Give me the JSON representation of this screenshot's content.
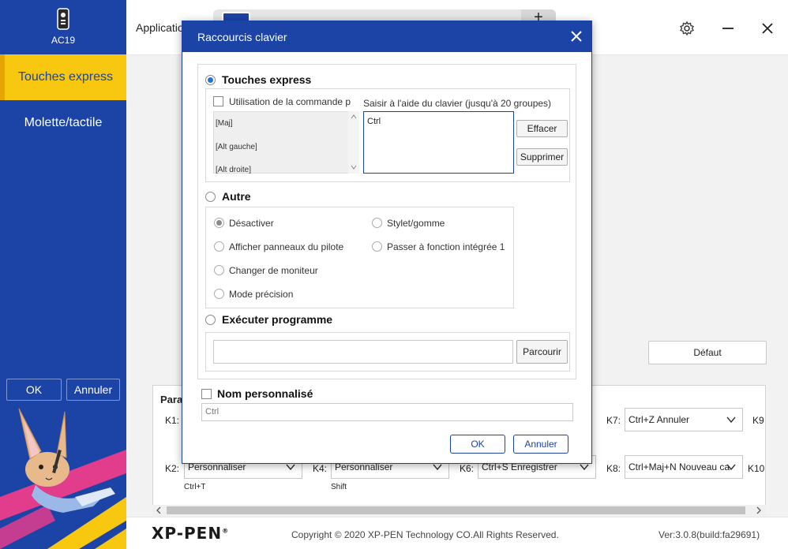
{
  "sidebar": {
    "device_name": "AC19",
    "items": [
      {
        "label": "Touches express",
        "active": true
      },
      {
        "label": "Molette/tactile",
        "active": false
      }
    ],
    "ok_label": "OK",
    "cancel_label": "Annuler",
    "accent": "#f7c80f",
    "background": "#1c43a6"
  },
  "header": {
    "app_label": "Application",
    "add_tab_label": "+",
    "icons": [
      "settings-icon",
      "minimize-icon",
      "close-icon"
    ]
  },
  "dialog": {
    "title": "Raccourcis clavier",
    "shortcut": {
      "label": "Touches express",
      "selected": true,
      "use_command_label": "Utilisation de la commande p",
      "modifiers": [
        "[Maj]",
        "[Alt gauche]",
        "[Alt droite]"
      ],
      "keyboard_hint": "Saisir à l'aide du clavier (jusqu'à 20 groupes)",
      "keys_value": "Ctrl",
      "clear_label": "Effacer",
      "delete_label": "Supprimer"
    },
    "other": {
      "label": "Autre",
      "selected": false,
      "options_left": [
        "Désactiver",
        "Afficher panneaux du pilote",
        "Changer de moniteur",
        "Mode précision"
      ],
      "options_right": [
        "Stylet/gomme",
        "Passer à fonction intégrée 1"
      ],
      "selected_option": "Désactiver"
    },
    "program": {
      "label": "Exécuter programme",
      "selected": false,
      "path_value": "",
      "browse_label": "Parcourir"
    },
    "custom_name": {
      "label": "Nom personnalisé",
      "checked": false,
      "value": "Ctrl"
    },
    "ok_label": "OK",
    "cancel_label": "Annuler"
  },
  "main": {
    "default_label": "Défaut",
    "params_title": "Para",
    "keys": [
      {
        "key": "K1:",
        "value": "",
        "sub": ""
      },
      {
        "key": "K7:",
        "value": "Ctrl+Z Annuler",
        "sub": ""
      },
      {
        "key": "K9",
        "value": "",
        "sub": ""
      },
      {
        "key": "K2:",
        "value": "Personnaliser",
        "sub": "Ctrl+T"
      },
      {
        "key": "K4:",
        "value": "Personnaliser",
        "sub": "Shift"
      },
      {
        "key": "K6:",
        "value": "Ctrl+S Enregistrer",
        "sub": ""
      },
      {
        "key": "K8:",
        "value": "Ctrl+Maj+N Nouveau ca",
        "sub": ""
      },
      {
        "key": "K10",
        "value": "",
        "sub": ""
      }
    ]
  },
  "footer": {
    "logo": "XP-PEN",
    "registered": "®",
    "copyright": "Copyright © 2020 XP-PEN Technology CO.All Rights Reserved.",
    "version": "Ver:3.0.8(build:fa29691)"
  }
}
